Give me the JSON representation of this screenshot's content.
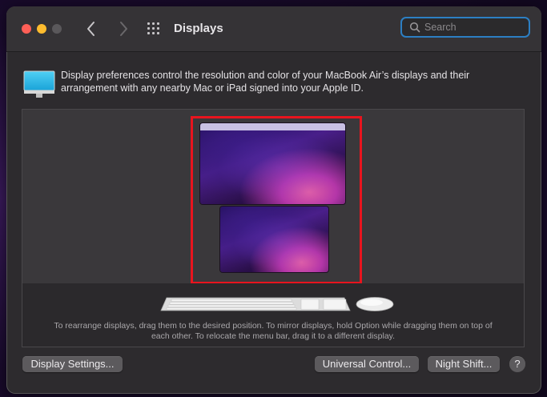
{
  "window": {
    "title": "Displays"
  },
  "search": {
    "placeholder": "Search",
    "value": ""
  },
  "description": "Display preferences control the resolution and color of your MacBook Air’s displays and their arrangement with any nearby Mac or iPad signed into your Apple ID.",
  "arrangement": {
    "hint": "To rearrange displays, drag them to the desired position. To mirror displays, hold Option while dragging them on top of each other. To relocate the menu bar, drag it to a different display."
  },
  "buttons": {
    "display_settings": "Display Settings...",
    "universal_control": "Universal Control...",
    "night_shift": "Night Shift...",
    "help": "?"
  },
  "colors": {
    "highlight": "#e8141e",
    "search_focus": "#2c7fc3",
    "close": "#fe5f57",
    "minimize": "#febc2e"
  },
  "icons": [
    "chevron-left-icon",
    "chevron-right-icon",
    "grid-icon",
    "search-icon",
    "monitor-icon",
    "keyboard-icon",
    "mouse-icon"
  ]
}
